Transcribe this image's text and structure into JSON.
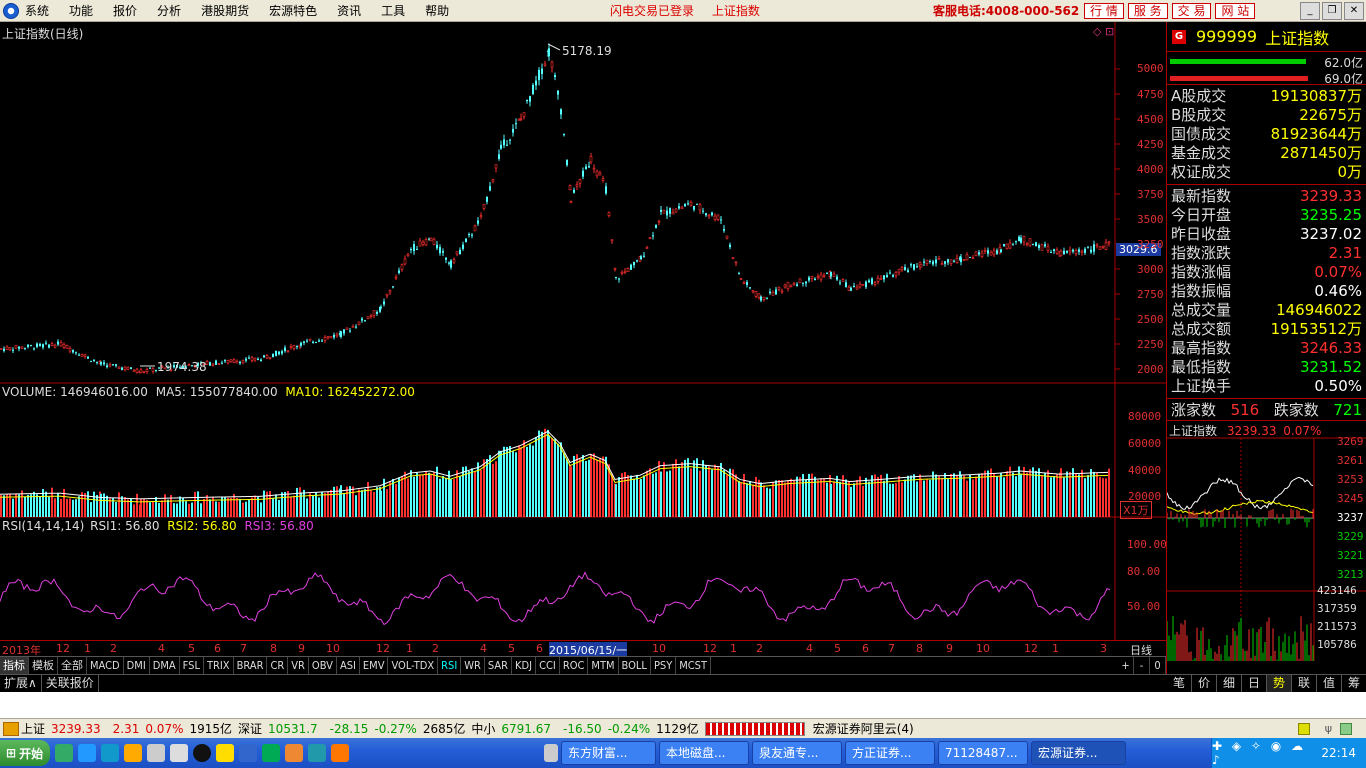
{
  "menu": [
    "系统",
    "功能",
    "报价",
    "分析",
    "港股期货",
    "宏源特色",
    "资讯",
    "工具",
    "帮助"
  ],
  "status_msg": [
    "闪电交易已登录",
    "上证指数"
  ],
  "phone": "客服电话:4008-000-562",
  "top_buttons": [
    "行 情",
    "服 务",
    "交 易",
    "网 站"
  ],
  "chart": {
    "title": "上证指数(日线)",
    "high_label": "5178.19",
    "low_label": "1974.38",
    "price_tag": "3029.6",
    "price_axis": [
      "5000",
      "4750",
      "4500",
      "4250",
      "4000",
      "3750",
      "3500",
      "3250",
      "3000",
      "2750",
      "2500",
      "2250",
      "2000"
    ],
    "volume_title": "VOLUME: 146946016.00",
    "ma5": "MA5: 155077840.00",
    "ma10": "MA10: 162452272.00",
    "volume_axis": [
      "80000",
      "60000",
      "40000",
      "20000"
    ],
    "volume_unit": "X1万",
    "rsi_title": "RSI(14,14,14)",
    "rsi1": "RSI1: 56.80",
    "rsi2": "RSI2: 56.80",
    "rsi3": "RSI3: 56.80",
    "rsi_axis": [
      "100.00",
      "80.00",
      "50.00"
    ],
    "time_axis": [
      "2013年",
      "12",
      "1",
      "2",
      "4",
      "5",
      "6",
      "7",
      "8",
      "9",
      "10",
      "12",
      "1",
      "2",
      "4",
      "5",
      "6",
      "2015/06/15/一",
      "10",
      "12",
      "1",
      "2",
      "4",
      "5",
      "6",
      "7",
      "8",
      "9",
      "10",
      "12",
      "1",
      "3"
    ],
    "period": "日线"
  },
  "indicator_tabs": [
    "指标",
    "模板",
    "全部",
    "MACD",
    "DMI",
    "DMA",
    "FSL",
    "TRIX",
    "BRAR",
    "CR",
    "VR",
    "OBV",
    "ASI",
    "EMV",
    "VOL-TDX",
    "RSI",
    "WR",
    "SAR",
    "KDJ",
    "CCI",
    "ROC",
    "MTM",
    "BOLL",
    "PSY",
    "MCST"
  ],
  "indicator_right": [
    "+",
    "-",
    "0"
  ],
  "bottom_tabs": [
    "扩展∧",
    "关联报价"
  ],
  "right_panel": {
    "code": "999999",
    "name": "上证指数",
    "bar1": "62.0亿",
    "bar2": "69.0亿",
    "rows1": [
      {
        "label": "A股成交",
        "value": "19130837万"
      },
      {
        "label": "B股成交",
        "value": "22675万"
      },
      {
        "label": "国债成交",
        "value": "81923644万"
      },
      {
        "label": "基金成交",
        "value": "2871450万"
      },
      {
        "label": "权证成交",
        "value": "0万"
      }
    ],
    "rows2": [
      {
        "label": "最新指数",
        "value": "3239.33",
        "c": "red"
      },
      {
        "label": "今日开盘",
        "value": "3235.25",
        "c": "grn"
      },
      {
        "label": "昨日收盘",
        "value": "3237.02",
        "c": "wht"
      },
      {
        "label": "指数涨跌",
        "value": "2.31",
        "c": "red"
      },
      {
        "label": "指数涨幅",
        "value": "0.07%",
        "c": "red"
      },
      {
        "label": "指数振幅",
        "value": "0.46%",
        "c": "wht"
      },
      {
        "label": "总成交量",
        "value": "146946022",
        "c": "ylw"
      },
      {
        "label": "总成交额",
        "value": "19153512万",
        "c": "ylw"
      },
      {
        "label": "最高指数",
        "value": "3246.33",
        "c": "red"
      },
      {
        "label": "最低指数",
        "value": "3231.52",
        "c": "grn"
      },
      {
        "label": "上证换手",
        "value": "0.50%",
        "c": "wht"
      }
    ],
    "up_label": "涨家数",
    "up": "516",
    "down_label": "跌家数",
    "down": "721",
    "mini_title": "上证指数",
    "mini_price": "3239.33",
    "mini_pct": "0.07%",
    "mini_axis": [
      "3269",
      "3261",
      "3253",
      "3245",
      "3237",
      "3229",
      "3221",
      "3213"
    ],
    "mini_vol": [
      "423146",
      "317359",
      "211573",
      "105786"
    ],
    "tabs": [
      "笔",
      "价",
      "细",
      "日",
      "势",
      "联",
      "值",
      "筹"
    ]
  },
  "statusbar": {
    "sh_name": "上证",
    "sh_price": "3239.33",
    "sh_chg": "2.31",
    "sh_pct": "0.07%",
    "sh_amt": "1915亿",
    "sz_name": "深证",
    "sz_price": "10531.7",
    "sz_chg": "-28.15",
    "sz_pct": "-0.27%",
    "sz_amt": "2685亿",
    "zx_name": "中小",
    "zx_price": "6791.67",
    "zx_chg": "-16.50",
    "zx_pct": "-0.24%",
    "zx_amt": "1129亿",
    "broker": "宏源证券阿里云(4)"
  },
  "taskbar": {
    "start": "开始",
    "items": [
      "东方财富...",
      "本地磁盘...",
      "泉友通专...",
      "方正证券...",
      "71128487...",
      "宏源证券..."
    ],
    "clock": "22:14"
  }
}
